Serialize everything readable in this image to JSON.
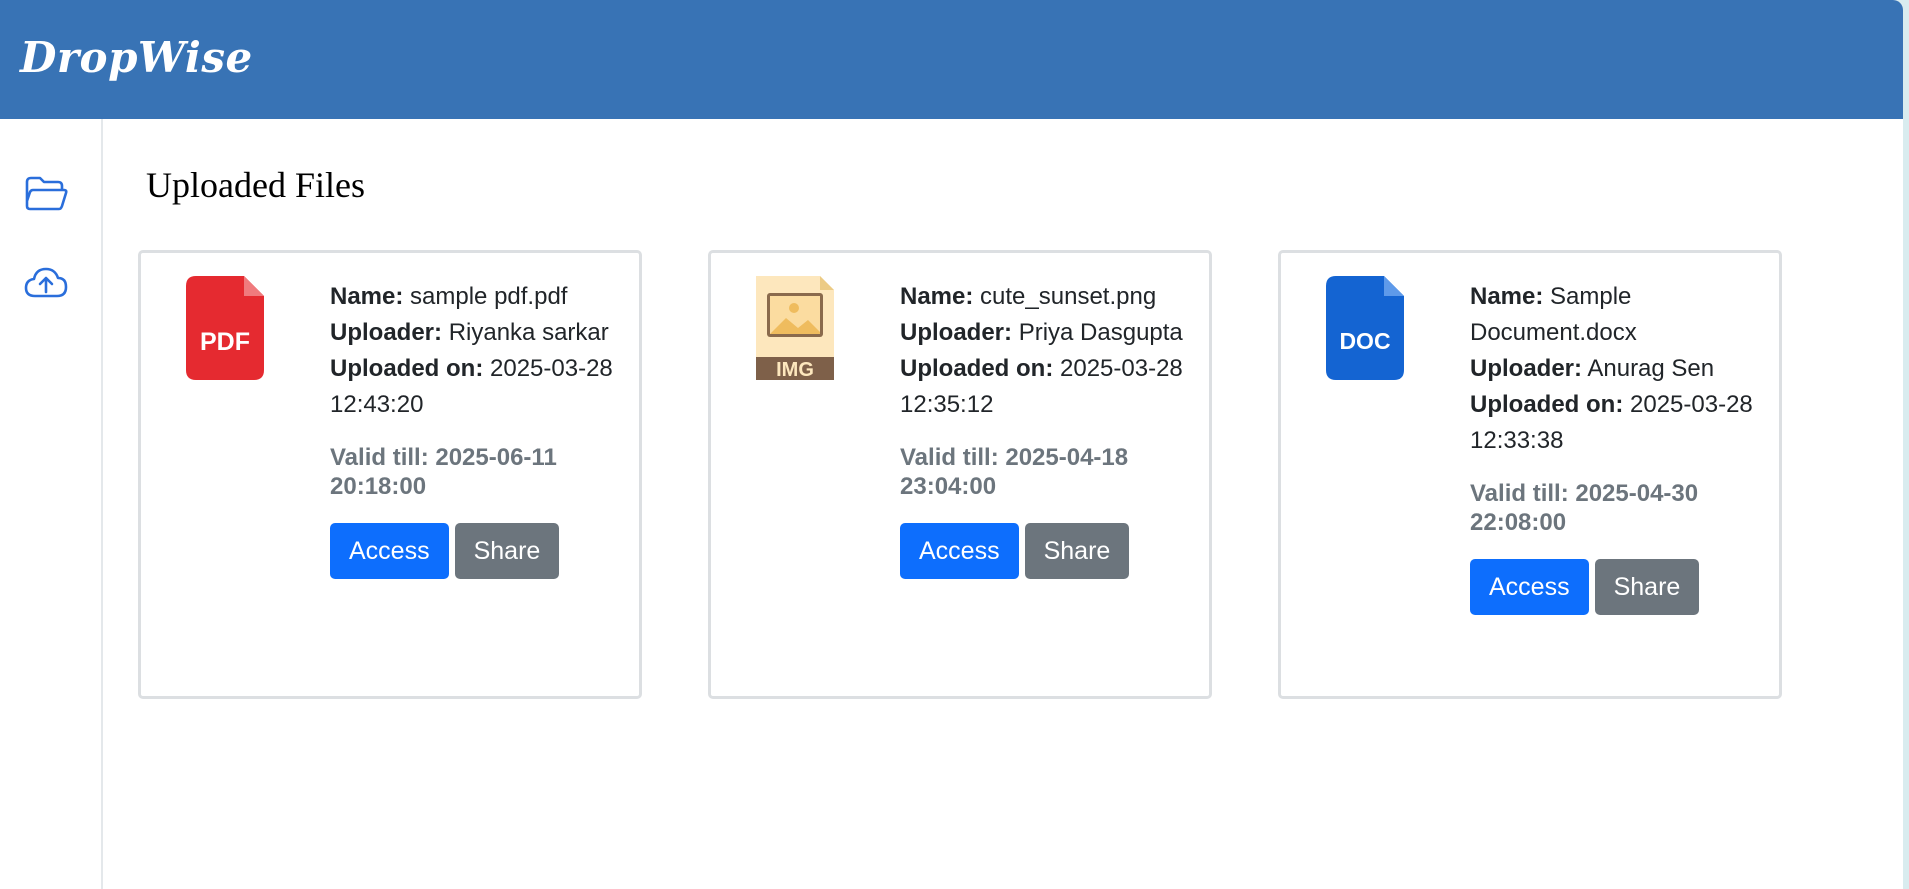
{
  "app": {
    "brand": "DropWise"
  },
  "sidebar": {
    "items": [
      {
        "icon": "folder-icon",
        "label": ""
      },
      {
        "icon": "cloud-upload-icon",
        "label": ""
      }
    ]
  },
  "main": {
    "title": "Uploaded Files",
    "labels": {
      "name": "Name:",
      "uploader": "Uploader:",
      "uploaded_on": "Uploaded on:"
    },
    "files": [
      {
        "type": "PDF",
        "icon_color": "#e52a30",
        "name": "sample pdf.pdf",
        "uploader": "Riyanka sarkar",
        "uploaded_on": "2025-03-28 12:43:20",
        "valid_till": "Valid till: 2025-06-11 20:18:00",
        "access_label": "Access",
        "share_label": "Share"
      },
      {
        "type": "IMG",
        "icon_color": "#f2c56a",
        "name": "cute_sunset.png",
        "uploader": "Priya Dasgupta",
        "uploaded_on": "2025-03-28 12:35:12",
        "valid_till": "Valid till: 2025-04-18 23:04:00",
        "access_label": "Access",
        "share_label": "Share"
      },
      {
        "type": "DOC",
        "icon_color": "#1464d2",
        "name": "Sample Document.docx",
        "uploader": "Anurag Sen",
        "uploaded_on": "2025-03-28 12:33:38",
        "valid_till": "Valid till: 2025-04-30 22:08:00",
        "access_label": "Access",
        "share_label": "Share"
      }
    ]
  },
  "colors": {
    "navbar": "#3873b5",
    "primary": "#0d6efd",
    "secondary": "#6c757d",
    "muted_text": "#6c757d"
  }
}
